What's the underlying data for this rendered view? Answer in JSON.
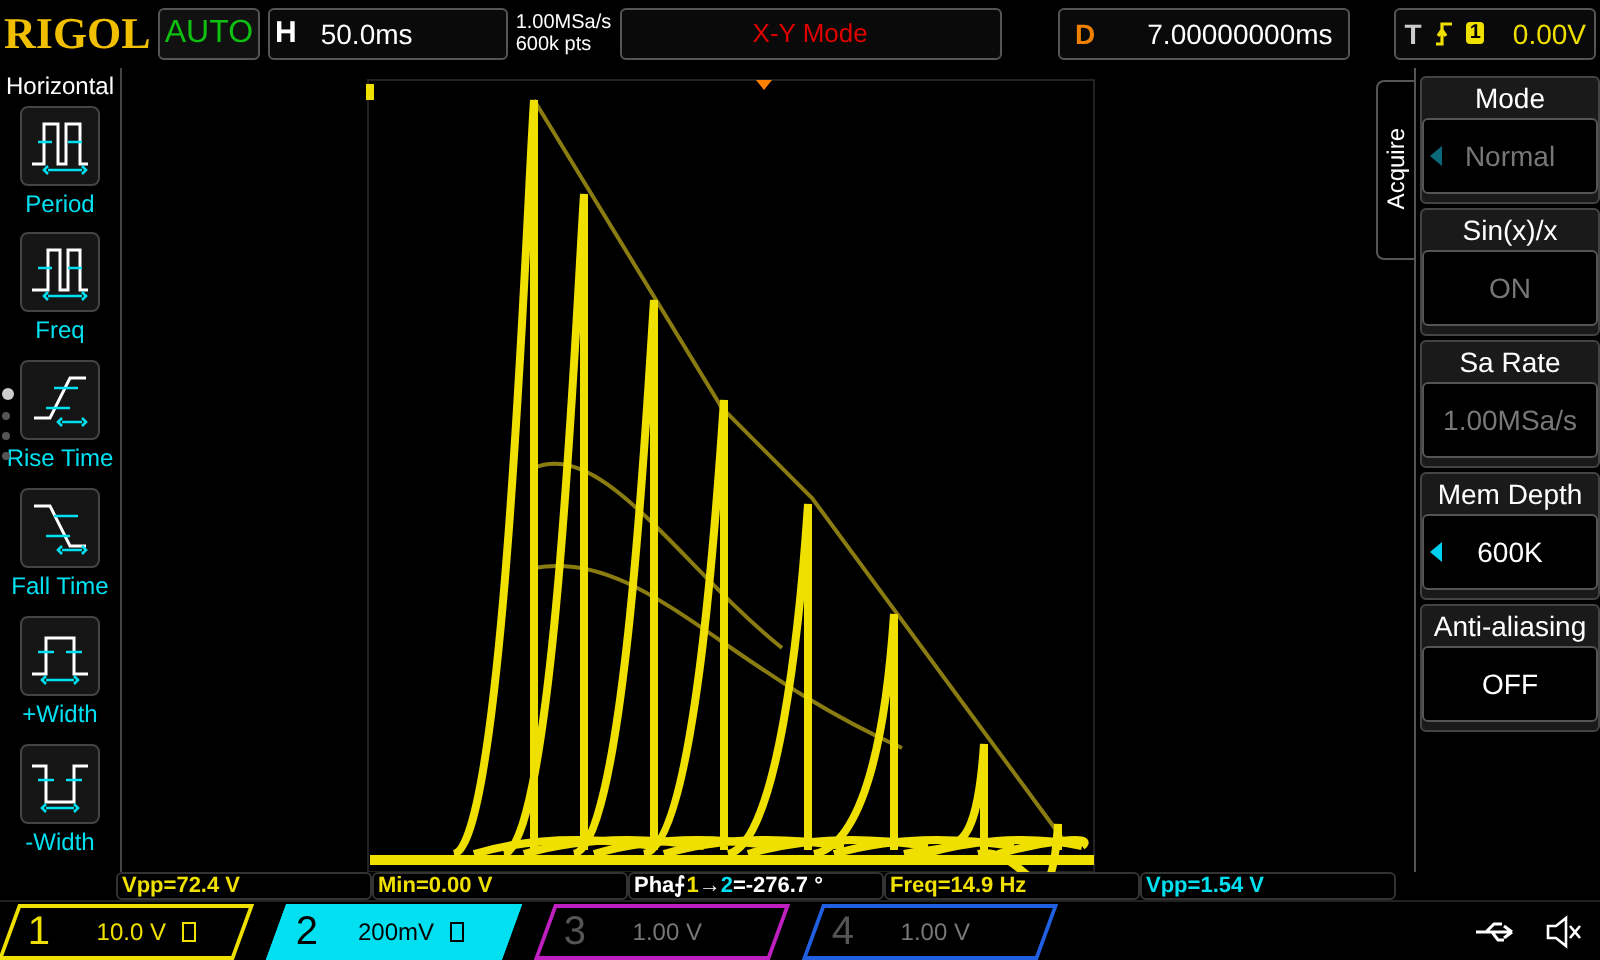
{
  "top_bar": {
    "logo": "RIGOL",
    "run_state": "AUTO",
    "timebase_label": "H",
    "timebase": "50.0ms",
    "sample_rate": "1.00MSa/s",
    "memory": "600k pts",
    "mode": "X-Y Mode",
    "delay_label": "D",
    "delay": "7.00000000ms",
    "trigger_label": "T",
    "trigger_source": "1",
    "trigger_level": "0.00V"
  },
  "sidebar": {
    "title": "Horizontal",
    "pages": [
      {
        "selected": true
      },
      {
        "selected": false
      },
      {
        "selected": false
      },
      {
        "selected": false
      }
    ],
    "items": [
      {
        "label": "Period"
      },
      {
        "label": "Freq"
      },
      {
        "label": "Rise Time"
      },
      {
        "label": "Fall Time"
      },
      {
        "label": "+Width"
      },
      {
        "label": "-Width"
      }
    ]
  },
  "menu": {
    "tab": "Acquire",
    "items": [
      {
        "title": "Mode",
        "value": "Normal",
        "arrow": true,
        "disabled": true
      },
      {
        "title": "Sin(x)/x",
        "value": "ON",
        "arrow": false,
        "disabled": true
      },
      {
        "title": "Sa Rate",
        "value": "1.00MSa/s",
        "arrow": false,
        "disabled": true
      },
      {
        "title": "Mem Depth",
        "value": "600K",
        "arrow": true,
        "disabled": false
      },
      {
        "title": "Anti-aliasing",
        "value": "OFF",
        "arrow": false,
        "disabled": false
      }
    ]
  },
  "measurements": [
    {
      "segments": [
        {
          "text": "Vpp=72.4 V",
          "color": "#f0e000"
        }
      ]
    },
    {
      "segments": [
        {
          "text": "Min=0.00 V",
          "color": "#f0e000"
        }
      ]
    },
    {
      "segments": [
        {
          "text": "Pha⨍",
          "color": "#ffffff"
        },
        {
          "text": "1",
          "color": "#f0e000"
        },
        {
          "text": "→",
          "color": "#ffffff"
        },
        {
          "text": "2",
          "color": "#00e0f0"
        },
        {
          "text": "=-276.7 °",
          "color": "#ffffff"
        }
      ]
    },
    {
      "segments": [
        {
          "text": "Freq=14.9 Hz",
          "color": "#f0e000"
        }
      ]
    },
    {
      "segments": [
        {
          "text": "Vpp=1.54 V",
          "color": "#00e0f0"
        }
      ]
    }
  ],
  "channels": [
    {
      "number": "1",
      "scale": "10.0 V",
      "on": true,
      "selected": false,
      "color": "#f0e000"
    },
    {
      "number": "2",
      "scale": "200mV",
      "on": true,
      "selected": true,
      "color": "#00e0f0"
    },
    {
      "number": "3",
      "scale": "1.00 V",
      "on": false,
      "selected": false,
      "color": "#c020c0"
    },
    {
      "number": "4",
      "scale": "1.00 V",
      "on": false,
      "selected": false,
      "color": "#2060e0"
    }
  ]
}
